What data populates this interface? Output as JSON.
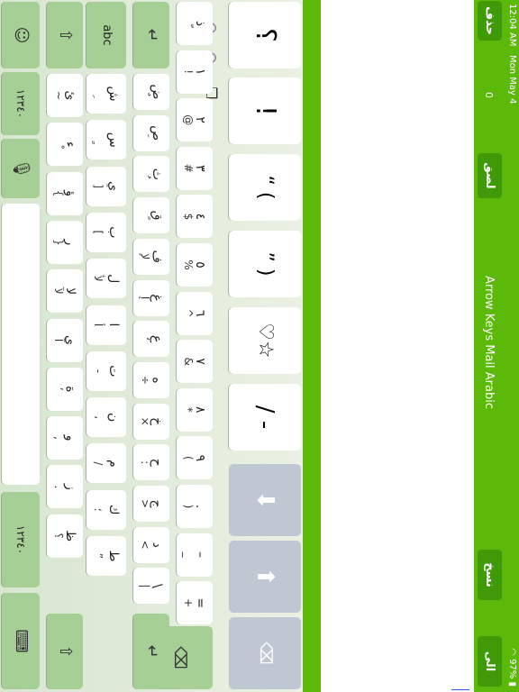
{
  "status": {
    "time": "12:04 AM",
    "date": "Mon May 4",
    "battery": "97%"
  },
  "header": {
    "delete_label": "حذف",
    "counter": "0",
    "append_label": "لصق",
    "title": "Arrow Keys Mail Arabic",
    "copy_label": "نسخ",
    "mail_label": "الى البريد"
  },
  "emoji_bar": [
    "؟",
    "!",
    "“ (",
    "” )",
    "♡☆",
    "/ -"
  ],
  "row1": [
    {
      "main": "=",
      "sub": "+"
    },
    {
      "main": "–",
      "sub": "_"
    },
    {
      "main": ".",
      "sub": ")"
    },
    {
      "main": "٩",
      "sub": "("
    },
    {
      "main": "٨",
      "sub": "*"
    },
    {
      "main": "٧",
      "sub": "&"
    },
    {
      "main": "٦",
      "sub": "^"
    },
    {
      "main": "٥",
      "sub": "%"
    },
    {
      "main": "٤",
      "sub": "$"
    },
    {
      "main": "٣",
      "sub": "#"
    },
    {
      "main": "٢",
      "sub": "@"
    },
    {
      "main": "١",
      "sub": "!"
    },
    {
      "main": "ذ",
      "sub": "ّ"
    }
  ],
  "row2": [
    {
      "main": "\\",
      "sub": "|"
    },
    {
      "main": "د",
      "sub": "<"
    },
    {
      "main": "ج",
      "sub": ">"
    },
    {
      "main": "ح",
      "sub": ":"
    },
    {
      "main": "خ",
      "sub": "×"
    },
    {
      "main": "ه",
      "sub": "÷"
    },
    {
      "main": "ع",
      "sub": "‘"
    },
    {
      "main": "غ",
      "sub": "إ"
    },
    {
      "main": "ف",
      "sub": "لإ"
    },
    {
      "main": "ق",
      "sub": "ً"
    },
    {
      "main": "ث",
      "sub": "ُ"
    },
    {
      "main": "ص",
      "sub": "َ"
    },
    {
      "main": "ض",
      "sub": "ٌ"
    }
  ],
  "row3": [
    {
      "main": "ط",
      "sub": "”"
    },
    {
      "main": "ك",
      "sub": "؛"
    },
    {
      "main": "م",
      "sub": "/"
    },
    {
      "main": "ن",
      "sub": "،"
    },
    {
      "main": "ت",
      "sub": "-"
    },
    {
      "main": "ا",
      "sub": "أ"
    },
    {
      "main": "ل",
      "sub": "لأ"
    },
    {
      "main": "ب",
      "sub": "["
    },
    {
      "main": "ي",
      "sub": "]"
    },
    {
      "main": "س",
      "sub": "ٍ"
    },
    {
      "main": "ش",
      "sub": "ِ"
    }
  ],
  "row4": [
    {
      "main": "ظ",
      "sub": "؟"
    },
    {
      "main": "ز",
      "sub": "."
    },
    {
      "main": "و",
      "sub": ","
    },
    {
      "main": "ة",
      "sub": "’"
    },
    {
      "main": "ى",
      "sub": "آ"
    },
    {
      "main": "لا",
      "sub": "لآ"
    },
    {
      "main": "ر",
      "sub": "}"
    },
    {
      "main": "ؤ",
      "sub": "{"
    },
    {
      "main": "ء",
      "sub": "ْ"
    },
    {
      "main": "ئ",
      "sub": "~"
    }
  ],
  "bottom": {
    "numbers_label_right": "١٢٣٤٠",
    "numbers_label_left": "١٢٣٤٠",
    "abc_label": "abc"
  },
  "colors": {
    "accent": "#5cb90a",
    "dark_button": "#3f9a08",
    "function_key": "#a6cf95"
  }
}
